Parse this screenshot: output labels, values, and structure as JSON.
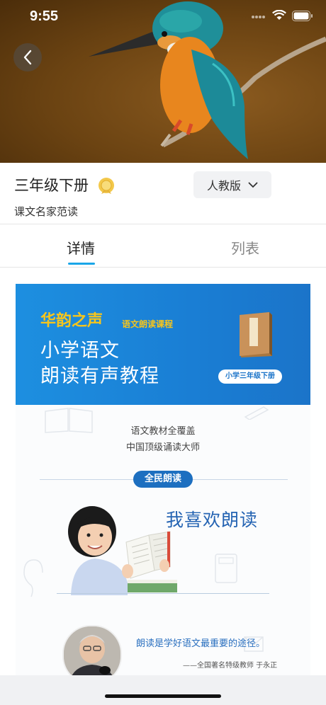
{
  "status_bar": {
    "time": "9:55"
  },
  "header": {
    "title": "三年级下册",
    "subtitle": "课文名家范读",
    "edition_label": "人教版"
  },
  "tabs": [
    {
      "label": "详情",
      "active": true
    },
    {
      "label": "列表",
      "active": false
    }
  ],
  "banner": {
    "brand": "华韵之声",
    "course": "语文朗读课程",
    "line1": "小学语文",
    "line2": "朗读有声教程",
    "pill": "小学三年级下册"
  },
  "intro": {
    "line1": "语文教材全覆盖",
    "line2": "中国顶级诵读大师",
    "badge": "全民朗读",
    "heading": "我喜欢朗读"
  },
  "quote": {
    "text": "朗读是学好语文最重要的途径。",
    "attribution": "——全国著名特级教师  于永正"
  },
  "colors": {
    "accent": "#1aa6e8",
    "banner_blue": "#1a7ed4",
    "brand_yellow": "#f6c51c"
  }
}
